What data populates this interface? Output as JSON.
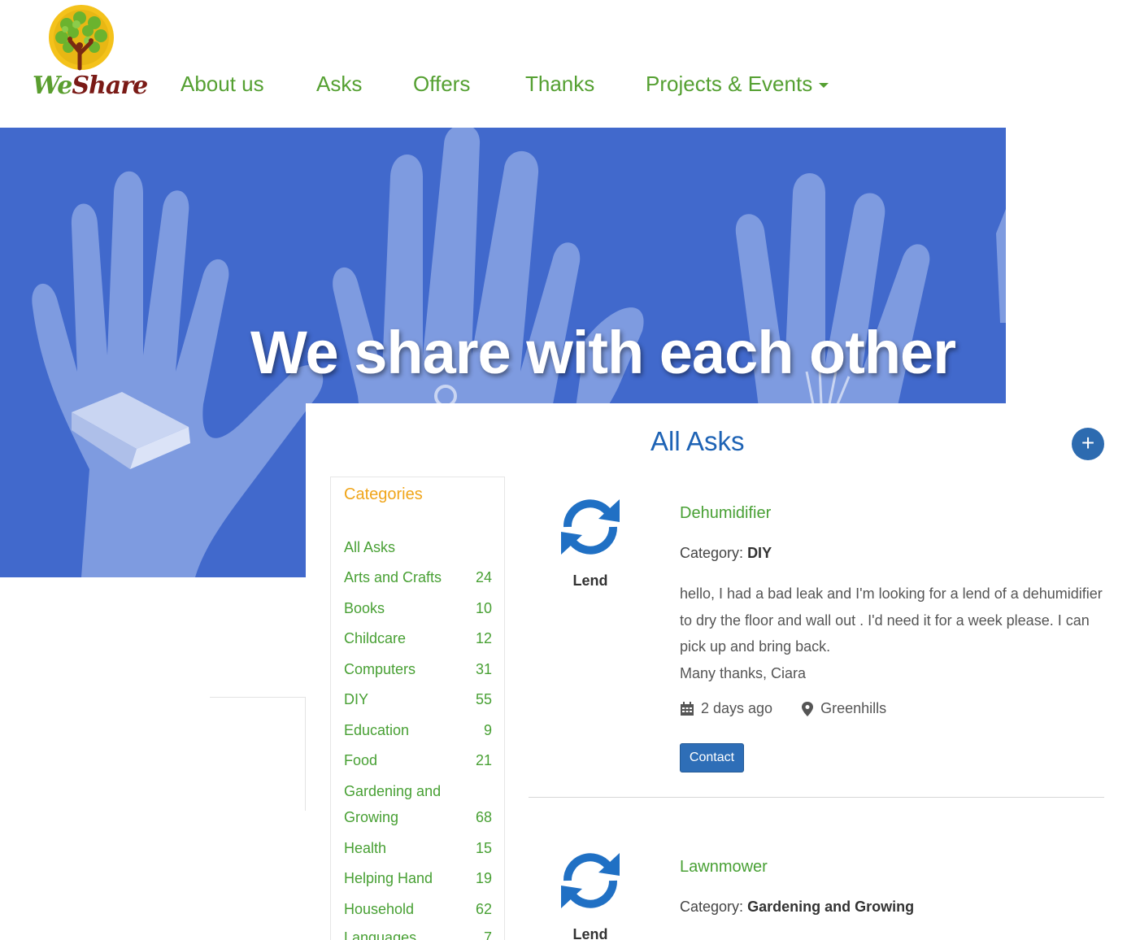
{
  "brand": {
    "logo_part1": "We",
    "logo_part2": "Share"
  },
  "nav": {
    "items": [
      "About us",
      "Asks",
      "Offers",
      "Thanks",
      "Projects & Events"
    ],
    "dropdown_icon": "caret-down-icon"
  },
  "hero": {
    "title": "We share with each other"
  },
  "main": {
    "title": "All Asks",
    "add_button": "+"
  },
  "categories": {
    "title": "Categories",
    "items": [
      {
        "name": "All Asks",
        "count": ""
      },
      {
        "name": "Arts and Crafts",
        "count": "24"
      },
      {
        "name": "Books",
        "count": "10"
      },
      {
        "name": "Childcare",
        "count": "12"
      },
      {
        "name": "Computers",
        "count": "31"
      },
      {
        "name": "DIY",
        "count": "55"
      },
      {
        "name": "Education",
        "count": "9"
      },
      {
        "name": "Food",
        "count": "21"
      },
      {
        "name": "Gardening and Growing",
        "count": "68"
      },
      {
        "name": "Health",
        "count": "15"
      },
      {
        "name": "Helping Hand",
        "count": "19"
      },
      {
        "name": "Household",
        "count": "62"
      },
      {
        "name": "Languages",
        "count": "7"
      }
    ]
  },
  "listings": [
    {
      "type": "Lend",
      "type_icon": "sync-arrows-icon",
      "title": "Dehumidifier",
      "category_label": "Category:",
      "category": "DIY",
      "description": "hello, I had a bad leak and I'm looking for a lend of a dehumidifier to dry the floor and wall out . I'd need it for a week please. I can pick up and bring back.",
      "signoff": "Many thanks, Ciara",
      "posted": "2 days ago",
      "location": "Greenhills",
      "contact_label": "Contact"
    },
    {
      "type": "Lend",
      "type_icon": "sync-arrows-icon",
      "title": "Lawnmower",
      "category_label": "Category:",
      "category": "Gardening and Growing"
    }
  ],
  "colors": {
    "nav_green": "#55a032",
    "hero_blue": "#4169cc",
    "title_blue": "#1e63b5",
    "category_orange": "#f0a51a",
    "button_blue": "#2e6eb7"
  }
}
